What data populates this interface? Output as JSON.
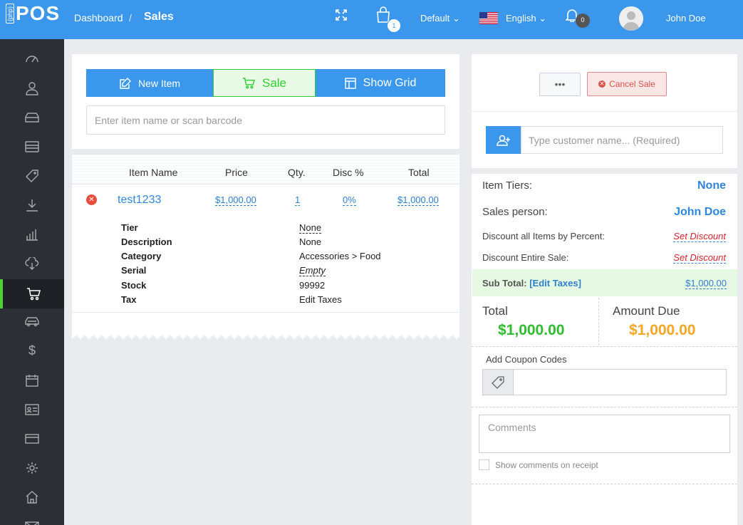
{
  "app": {
    "logo_small": "(php)",
    "logo_big": "POS"
  },
  "header": {
    "breadcrumb_dashboard": "Dashboard",
    "breadcrumb_sep": "/",
    "breadcrumb_current": "Sales",
    "cart_count": "1",
    "register": "Default",
    "language": "English",
    "notifications_count": "0",
    "user_name": "John Doe"
  },
  "sidebar": {
    "items": [
      {
        "icon": "dashboard-icon"
      },
      {
        "icon": "customers-icon"
      },
      {
        "icon": "items-icon"
      },
      {
        "icon": "item-kits-icon"
      },
      {
        "icon": "price-rules-icon"
      },
      {
        "icon": "receivings-icon"
      },
      {
        "icon": "reports-icon"
      },
      {
        "icon": "cloud-icon"
      },
      {
        "icon": "sales-icon",
        "active": true
      },
      {
        "icon": "deliveries-icon"
      },
      {
        "icon": "expenses-icon"
      },
      {
        "icon": "appointments-icon"
      },
      {
        "icon": "employees-icon"
      },
      {
        "icon": "gift-cards-icon"
      },
      {
        "icon": "settings-icon"
      },
      {
        "icon": "locations-icon"
      },
      {
        "icon": "messages-icon"
      }
    ]
  },
  "toolbar": {
    "new_item": "New Item",
    "sale": "Sale",
    "show_grid": "Show Grid",
    "search_placeholder": "Enter item name or scan barcode"
  },
  "cart_table": {
    "headers": {
      "name": "Item Name",
      "price": "Price",
      "qty": "Qty.",
      "disc": "Disc %",
      "total": "Total"
    },
    "row": {
      "name": "test1233",
      "price": "$1,000.00",
      "qty": "1",
      "disc": "0%",
      "total": "$1,000.00"
    },
    "details": [
      {
        "key": "Tier",
        "value": "None"
      },
      {
        "key": "Description",
        "value": "None"
      },
      {
        "key": "Category",
        "value": "Accessories > Food"
      },
      {
        "key": "Serial",
        "value": "Empty"
      },
      {
        "key": "Stock",
        "value": "99992"
      },
      {
        "key": "Tax",
        "value": "Edit Taxes"
      }
    ]
  },
  "register_panel": {
    "more_label": "•••",
    "cancel_sale": "Cancel Sale",
    "customer_placeholder": "Type customer name... (Required)",
    "item_tiers_label": "Item Tiers:",
    "item_tiers_value": "None",
    "sales_person_label": "Sales person:",
    "sales_person_value": "John Doe",
    "discount_items_label": "Discount all Items by Percent:",
    "discount_items_link": "Set Discount",
    "discount_sale_label": "Discount Entire Sale:",
    "discount_sale_link": "Set Discount",
    "subtotal_label": "Sub Total:",
    "edit_taxes": "[Edit Taxes]",
    "subtotal_value": "$1,000.00",
    "total_label": "Total",
    "total_value": "$1,000.00",
    "amount_due_label": "Amount Due",
    "amount_due_value": "$1,000.00",
    "coupon_label": "Add Coupon Codes",
    "comments_placeholder": "Comments",
    "show_comments": "Show comments on receipt"
  },
  "colors": {
    "primary": "#3b97eb",
    "success": "#2fcf2f",
    "total_green": "#2dbd2d",
    "amount_due_orange": "#f5a623",
    "danger": "#d9534f"
  }
}
